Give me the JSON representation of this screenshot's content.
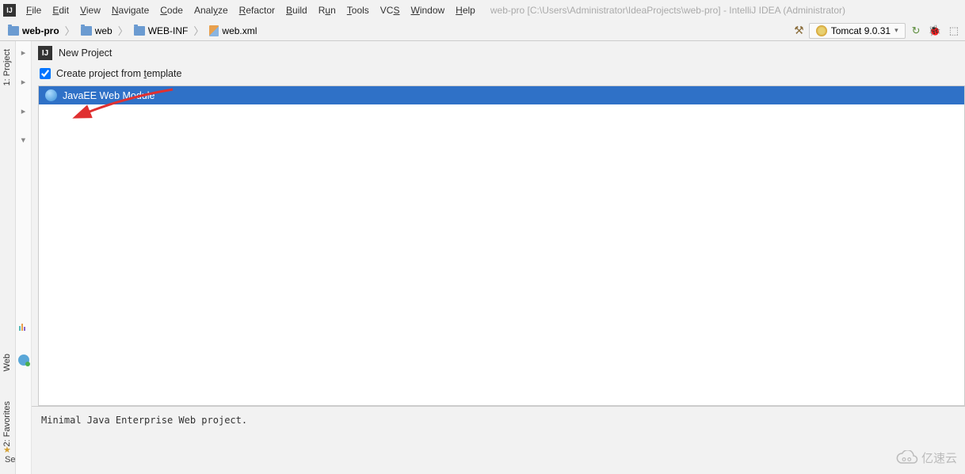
{
  "menubar": {
    "items": [
      {
        "label": "File",
        "u": 0
      },
      {
        "label": "Edit",
        "u": 0
      },
      {
        "label": "View",
        "u": 0
      },
      {
        "label": "Navigate",
        "u": 0
      },
      {
        "label": "Code",
        "u": 0
      },
      {
        "label": "Analyze",
        "u": 4
      },
      {
        "label": "Refactor",
        "u": 0
      },
      {
        "label": "Build",
        "u": 0
      },
      {
        "label": "Run",
        "u": 1
      },
      {
        "label": "Tools",
        "u": 0
      },
      {
        "label": "VCS",
        "u": 2
      },
      {
        "label": "Window",
        "u": 0
      },
      {
        "label": "Help",
        "u": 0
      }
    ],
    "title": "web-pro [C:\\Users\\Administrator\\IdeaProjects\\web-pro] - IntelliJ IDEA (Administrator)"
  },
  "breadcrumb": {
    "items": [
      {
        "label": "web-pro",
        "bold": true,
        "icon": "folder"
      },
      {
        "label": "web",
        "icon": "folder"
      },
      {
        "label": "WEB-INF",
        "icon": "folder"
      },
      {
        "label": "web.xml",
        "icon": "file"
      }
    ]
  },
  "run": {
    "config_label": "Tomcat 9.0.31"
  },
  "left_tools": {
    "project_label": "1: Project",
    "web_label": "Web",
    "favorites_label": "2: Favorites"
  },
  "dialog": {
    "title": "New Project",
    "checkbox_label_before": "Create project from ",
    "checkbox_label_u": "t",
    "checkbox_label_after": "emplate",
    "checkbox_checked": true,
    "templates": [
      {
        "label": "JavaEE Web Module",
        "selected": true
      }
    ],
    "description": "Minimal Java Enterprise Web project."
  },
  "se_label": "Se",
  "watermark_text": "亿速云"
}
